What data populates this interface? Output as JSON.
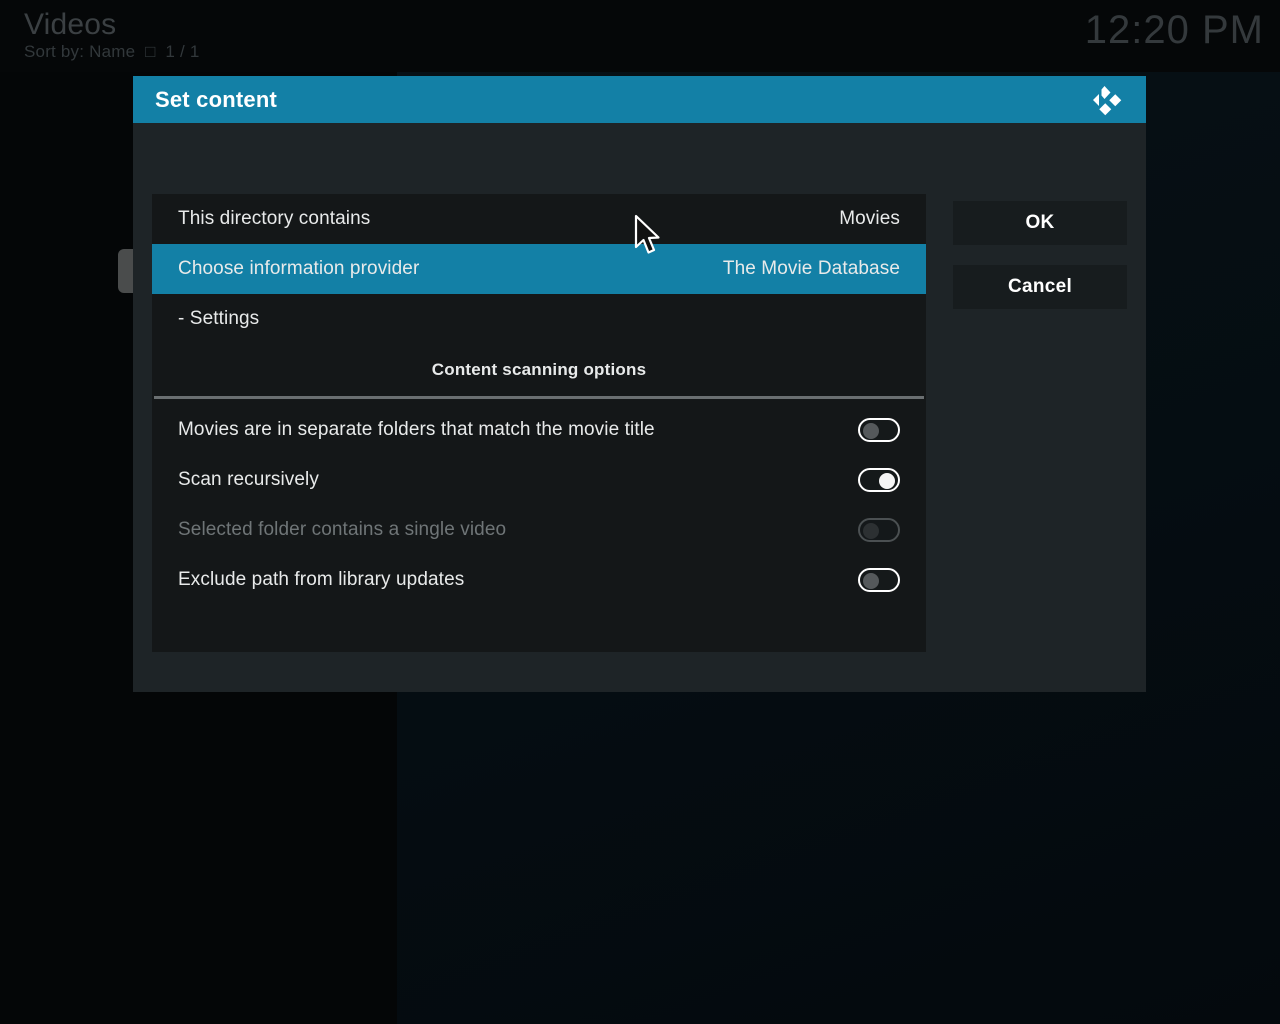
{
  "background": {
    "window_title": "Videos",
    "sort_line": "Sort by: Name  □  1 / 1",
    "clock": "12:20 PM"
  },
  "dialog": {
    "title": "Set content",
    "logo_icon": "kodi-logo-icon",
    "accent_color": "#1380a6",
    "panel_color": "#141718",
    "body_color": "#1e2427",
    "rows": [
      {
        "label": "This directory contains",
        "value": "Movies",
        "selected": false
      },
      {
        "label": "Choose information provider",
        "value": "The Movie Database",
        "selected": true
      },
      {
        "label": "- Settings",
        "value": "",
        "selected": false
      }
    ],
    "section_title": "Content scanning options",
    "options": [
      {
        "label": "Movies are in separate folders that match the movie title",
        "state": "off",
        "disabled": false
      },
      {
        "label": "Scan recursively",
        "state": "on",
        "disabled": false
      },
      {
        "label": "Selected folder contains a single video",
        "state": "off",
        "disabled": true
      },
      {
        "label": "Exclude path from library updates",
        "state": "off",
        "disabled": false
      }
    ],
    "buttons": {
      "ok": "OK",
      "cancel": "Cancel"
    }
  }
}
